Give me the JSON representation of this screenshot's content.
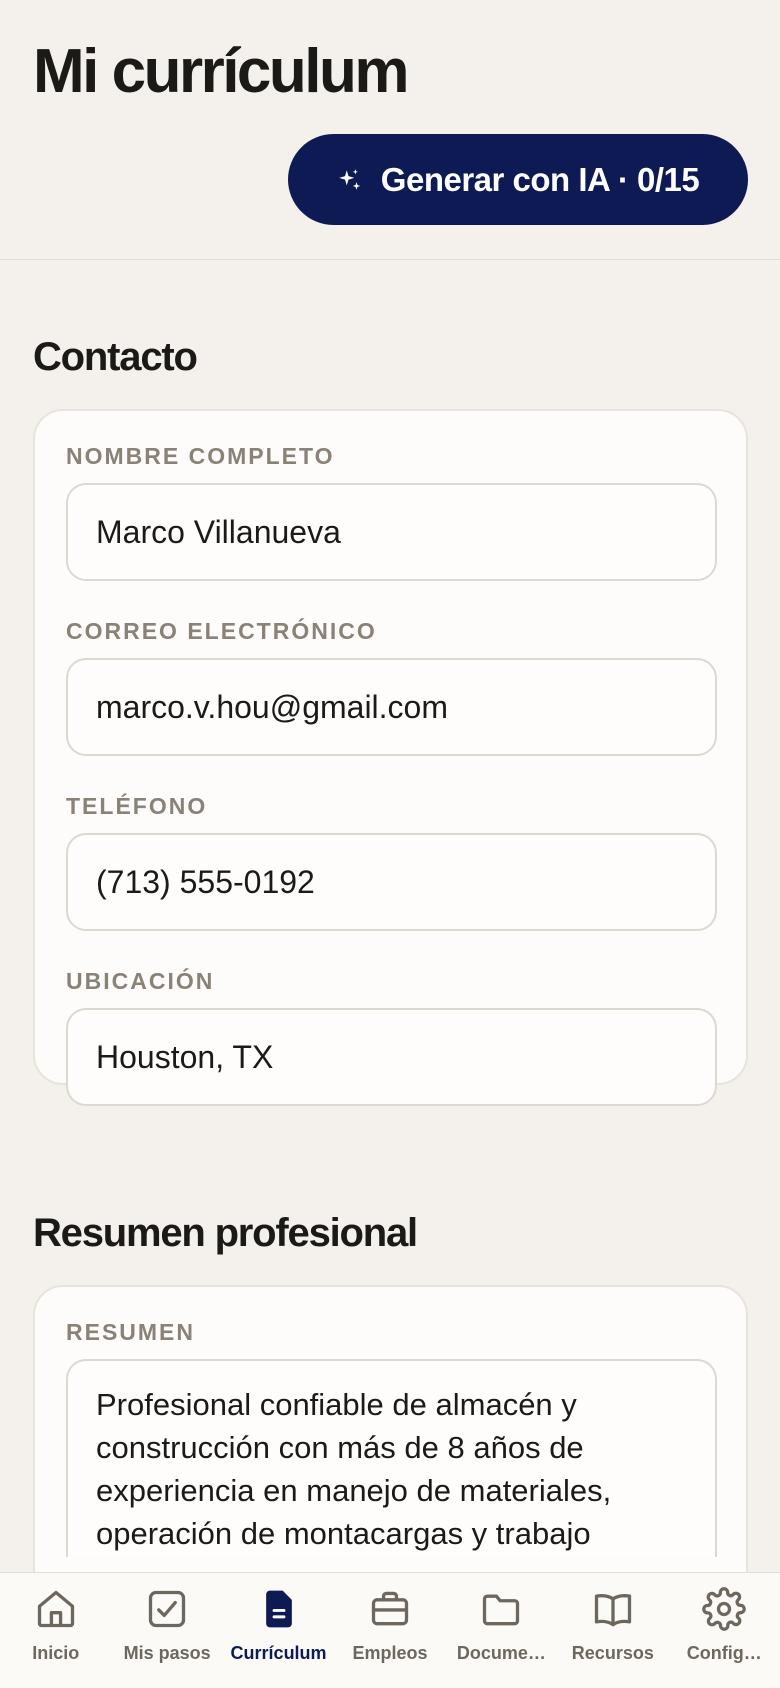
{
  "header": {
    "title": "Mi currículum",
    "ai_button_label": "Generar con IA · 0/15"
  },
  "contact": {
    "section_title": "Contacto",
    "fields": [
      {
        "label": "NOMBRE COMPLETO",
        "value": "Marco Villanueva"
      },
      {
        "label": "CORREO ELECTRÓNICO",
        "value": "marco.v.hou@gmail.com"
      },
      {
        "label": "TELÉFONO",
        "value": "(713) 555-0192"
      },
      {
        "label": "UBICACIÓN",
        "value": "Houston, TX"
      }
    ]
  },
  "summary": {
    "section_title": "Resumen profesional",
    "label": "RESUMEN",
    "value": "Profesional confiable de almacén y construcción con más de 8 años de experiencia en manejo de materiales, operación de montacargas y trabajo"
  },
  "nav": {
    "active": "curriculum",
    "items": [
      {
        "id": "inicio",
        "label": "Inicio",
        "icon": "home-icon"
      },
      {
        "id": "mis-pasos",
        "label": "Mis pasos",
        "icon": "checkbox-icon"
      },
      {
        "id": "curriculum",
        "label": "Currículum",
        "icon": "document-icon"
      },
      {
        "id": "empleos",
        "label": "Empleos",
        "icon": "briefcase-icon"
      },
      {
        "id": "documentos",
        "label": "Docume…",
        "icon": "folder-icon"
      },
      {
        "id": "recursos",
        "label": "Recursos",
        "icon": "book-icon"
      },
      {
        "id": "config",
        "label": "Config…",
        "icon": "gear-icon"
      }
    ]
  },
  "colors": {
    "accent": "#0d1a54",
    "background": "#f4f0eb",
    "card": "#fdfcfa",
    "label": "#8a8177"
  }
}
